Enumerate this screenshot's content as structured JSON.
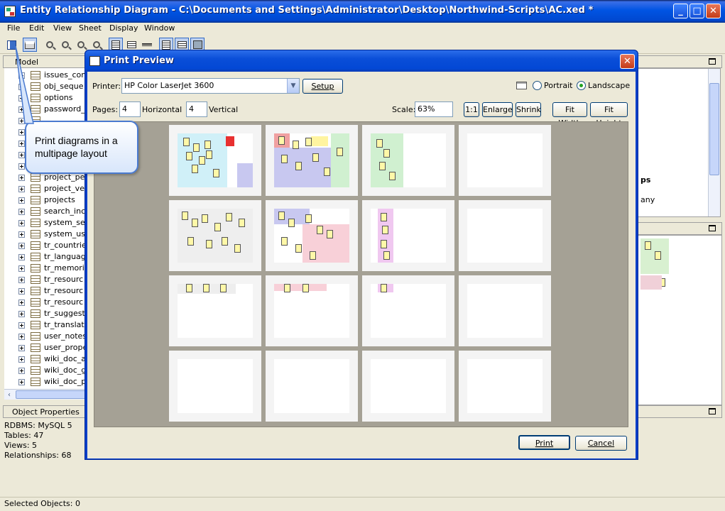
{
  "window": {
    "title": "Entity Relationship Diagram - C:\\Documents and Settings\\Administrator\\Desktop\\Northwind-Scripts\\AC.xed *"
  },
  "menu": [
    "File",
    "Edit",
    "View",
    "Sheet",
    "Display",
    "Window"
  ],
  "toolbar": {
    "icons": [
      "save-icon",
      "print-icon",
      "zoom-fit-icon",
      "zoom-in-icon",
      "zoom-out-icon",
      "zoom-icon",
      "layout-1-icon",
      "layout-2-icon",
      "layout-3-icon",
      "layout-4-icon",
      "layout-5-icon",
      "layout-6-icon"
    ]
  },
  "model_pane": {
    "title": "Model"
  },
  "tree_items": [
    "issues_com",
    "obj_seque",
    "options",
    "password_",
    "",
    "",
    "",
    "",
    "",
    "project_pe",
    "project_ve",
    "projects",
    "search_inc",
    "system_se",
    "system_us",
    "tr_countrie",
    "tr_languag",
    "tr_memorie",
    "tr_resourc",
    "tr_resourc",
    "tr_resourc",
    "tr_suggest",
    "tr_translat",
    "user_notes",
    "user_prope",
    "wiki_doc_a",
    "wiki_doc_g",
    "wiki_doc_p"
  ],
  "right_pane": {
    "heading": "ps",
    "text": "any"
  },
  "object_properties": {
    "title": "Object Properties",
    "lines": [
      "RDBMS: MySQL 5",
      "Tables: 47",
      "Views: 5",
      "Relationships: 68"
    ]
  },
  "status": "Selected Objects: 0",
  "tooltip": {
    "line1": "Print diagrams in a",
    "line2": "multipage layout"
  },
  "dialog": {
    "title": "Print Preview",
    "printer_label": "Printer:",
    "printer_value": "HP Color LaserJet 3600",
    "setup_label": "Setup",
    "portrait_label": "Portrait",
    "landscape_label": "Landscape",
    "orientation": "Landscape",
    "pages_label": "Pages:",
    "pages_h": "4",
    "horizontal_label": "Horizontal",
    "pages_v": "4",
    "vertical_label": "Vertical",
    "scale_label": "Scale:",
    "scale_value": "63%",
    "btn_1to1": "1:1",
    "btn_enlarge": "Enlarge",
    "btn_shrink": "Shrink",
    "btn_fitwidth": "Fit Width",
    "btn_fitheight": "Fit Height",
    "print_label": "Print",
    "cancel_label": "Cancel"
  },
  "colors": {
    "titlebar": "#0054e3",
    "dialog_frame": "#0a3fc8",
    "preview_bg": "#a5a195",
    "tooltip_border": "#4a7ad0"
  }
}
